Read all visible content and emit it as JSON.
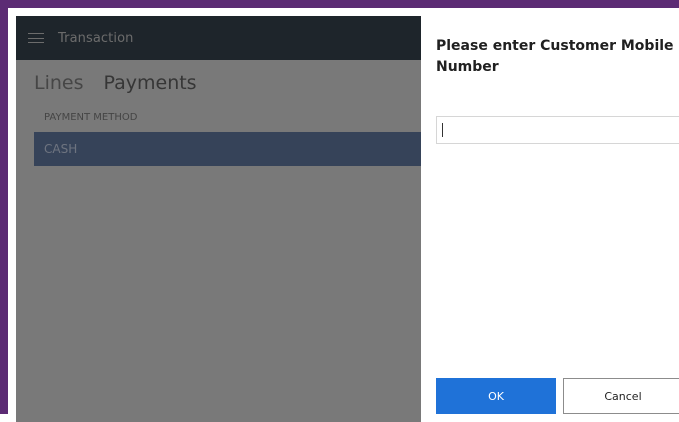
{
  "app": {
    "title": "Transaction"
  },
  "tabs": [
    {
      "label": "Lines"
    },
    {
      "label": "Payments"
    }
  ],
  "payments_table": {
    "header": "PAYMENT METHOD",
    "rows": [
      {
        "method": "CASH"
      }
    ]
  },
  "dialog": {
    "title": "Please enter Customer Mobile Number",
    "input_value": "",
    "ok_label": "OK",
    "cancel_label": "Cancel"
  },
  "colors": {
    "accent": "#1f72d8",
    "header_background": "#3d4b57",
    "selected_row": "#6c87b3",
    "window_border": "#5c2b74"
  },
  "icons": {
    "menu": "hamburger-menu-icon"
  }
}
